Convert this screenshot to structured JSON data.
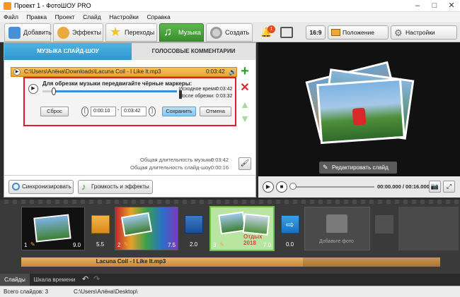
{
  "window": {
    "title": "Проект 1 - ФотоШОУ PRO"
  },
  "menu": [
    "Файл",
    "Правка",
    "Проект",
    "Слайд",
    "Настройки",
    "Справка"
  ],
  "tabs": [
    {
      "label": "Добавить"
    },
    {
      "label": "Эффекты"
    },
    {
      "label": "Переходы"
    },
    {
      "label": "Музыка"
    },
    {
      "label": "Создать"
    }
  ],
  "toolbar": {
    "notification_count": "1",
    "aspect": "16:9",
    "photo_position": "Положение фото",
    "project_settings": "Настройки проекта"
  },
  "music_panel": {
    "tab_music": "МУЗЫКА СЛАЙД-ШОУ",
    "tab_voice": "ГОЛОСОВЫЕ КОММЕНТАРИИ",
    "track_path": "C:\\Users\\Алёна\\Downloads\\Lacuna Coil - I Like It.mp3",
    "track_duration": "0:03:42",
    "trim_hint": "Для обрезки музыки передвигайте чёрные маркеры:",
    "original_time_label": "Исходное время:",
    "original_time": "0:03:42",
    "after_trim_label": "После обрезки:",
    "after_trim": "0:03:32",
    "reset": "Сброс",
    "start": "0:00:10",
    "end": "0:03:42",
    "save": "Сохранить",
    "cancel": "Отмена",
    "music_total_label": "Общая длительность музыки:",
    "music_total": "0:03:42",
    "slideshow_total_label": "Общая длительность слайд-шоу:",
    "slideshow_total": "0:00:16",
    "sync": "Синхронизировать",
    "volume_effects": "Громкость и эффекты"
  },
  "preview": {
    "edit_slide": "Редактировать слайд",
    "time": "00:00.000 / 00:16.000",
    "progress": 0
  },
  "timeline": {
    "slides": [
      {
        "num": "1",
        "duration": "9.0"
      },
      {
        "num": "2",
        "duration": "7.5"
      },
      {
        "num": "3",
        "duration": "7.0",
        "caption": "Отдых 2018"
      }
    ],
    "transitions": [
      "5.5",
      "2.0",
      "0.0"
    ],
    "add_photo": "Добавьте фото",
    "audio_label": "Lacuna Coil - I Like It.mp3"
  },
  "bottom_tabs": [
    "Слайды",
    "Шкала времени"
  ],
  "status": {
    "total_slides": "Всего слайдов: 3",
    "path": "C:\\Users\\Алёна\\Desktop\\"
  }
}
